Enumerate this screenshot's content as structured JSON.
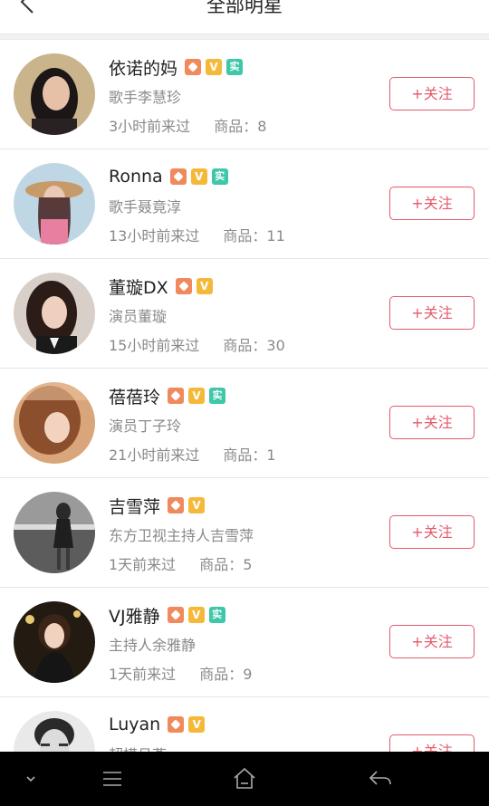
{
  "header": {
    "title": "全部明星"
  },
  "follow_label": "+关注",
  "goods_prefix": "商品：",
  "badges": {
    "verified_v": "V",
    "real_name": "实"
  },
  "colors": {
    "accent": "#e35a6b",
    "shop_badge": "#f08a5d",
    "v_badge": "#f5b93a",
    "real_badge": "#3ec7a8"
  },
  "stars": [
    {
      "name": "依诺的妈",
      "title": "歌手李慧珍",
      "last_seen": "3小时前来过",
      "goods": "8",
      "badges": [
        "shop",
        "v",
        "real"
      ]
    },
    {
      "name": "Ronna",
      "title": "歌手聂竟淳",
      "last_seen": "13小时前来过",
      "goods": "11",
      "badges": [
        "shop",
        "v",
        "real"
      ]
    },
    {
      "name": "董璇DX",
      "title": "演员董璇",
      "last_seen": "15小时前来过",
      "goods": "30",
      "badges": [
        "shop",
        "v"
      ]
    },
    {
      "name": "蓓蓓玲",
      "title": "演员丁子玲",
      "last_seen": "21小时前来过",
      "goods": "1",
      "badges": [
        "shop",
        "v",
        "real"
      ]
    },
    {
      "name": "吉雪萍",
      "title": "东方卫视主持人吉雪萍",
      "last_seen": "1天前来过",
      "goods": "5",
      "badges": [
        "shop",
        "v"
      ]
    },
    {
      "name": "VJ雅静",
      "title": "主持人余雅静",
      "last_seen": "1天前来过",
      "goods": "9",
      "badges": [
        "shop",
        "v",
        "real"
      ]
    },
    {
      "name": "Luyan",
      "title": "超模吕燕",
      "last_seen": "",
      "goods": "",
      "badges": [
        "shop",
        "v"
      ]
    }
  ],
  "nav": [
    "chevron-down-icon",
    "menu-icon",
    "home-icon",
    "back-arrow-icon"
  ]
}
